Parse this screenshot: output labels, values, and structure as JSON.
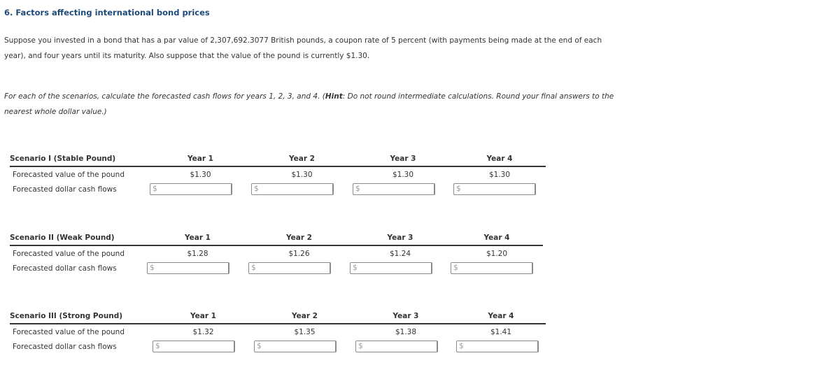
{
  "question": {
    "title": "6. Factors affecting international bond prices",
    "intro": "Suppose you invested in a bond that has a par value of 2,307,692.3077 British pounds, a coupon rate of 5 percent (with payments being made at the end of each year), and four years until its maturity. Also suppose that the value of the pound is currently $1.30.",
    "instructions_before_hint": "For each of the scenarios, calculate the forecasted cash flows for years 1, 2, 3, and 4. (",
    "hint_label": "Hint",
    "instructions_after_hint": ": Do not round intermediate calculations. Round your final answers to the nearest whole dollar value.)"
  },
  "row_labels": {
    "forecasted_value": "Forecasted value of the pound",
    "forecasted_cash_flows": "Forecasted dollar cash flows"
  },
  "currency_symbol": "$",
  "scenarios": [
    {
      "title": "Scenario I (Stable Pound)",
      "years": [
        "Year 1",
        "Year 2",
        "Year 3",
        "Year 4"
      ],
      "pound_values": [
        "$1.30",
        "$1.30",
        "$1.30",
        "$1.30"
      ],
      "cash_flow_inputs": [
        "",
        "",
        "",
        ""
      ]
    },
    {
      "title": "Scenario II (Weak Pound)",
      "years": [
        "Year 1",
        "Year 2",
        "Year 3",
        "Year 4"
      ],
      "pound_values": [
        "$1.28",
        "$1.26",
        "$1.24",
        "$1.20"
      ],
      "cash_flow_inputs": [
        "",
        "",
        "",
        ""
      ]
    },
    {
      "title": "Scenario III (Strong Pound)",
      "years": [
        "Year 1",
        "Year 2",
        "Year 3",
        "Year 4"
      ],
      "pound_values": [
        "$1.32",
        "$1.35",
        "$1.38",
        "$1.41"
      ],
      "cash_flow_inputs": [
        "",
        "",
        "",
        ""
      ]
    }
  ],
  "colors": {
    "title": "#1f4b7a",
    "body_text": "#333333",
    "input_border": "#8a8a8a",
    "placeholder": "#9a9a9a"
  }
}
